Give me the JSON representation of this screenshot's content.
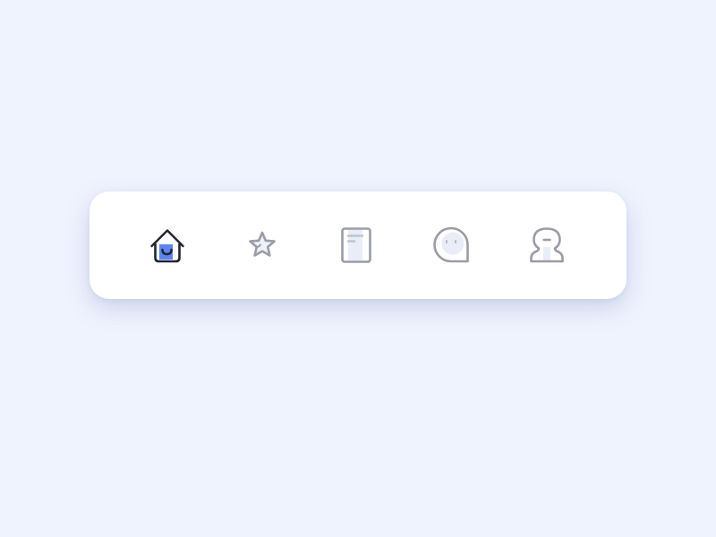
{
  "tabbar": {
    "active_index": 0,
    "colors": {
      "active_stroke": "#23232d",
      "active_fill": "#5b85f5",
      "inactive_stroke": "#9b9ca6",
      "inactive_fill": "#e9edf8",
      "card_background": "#ffffff",
      "page_background": "#eff3fe"
    },
    "tabs": [
      {
        "icon": "home-icon",
        "label": ""
      },
      {
        "icon": "star-icon",
        "label": ""
      },
      {
        "icon": "document-icon",
        "label": ""
      },
      {
        "icon": "chat-bubble-icon",
        "label": ""
      },
      {
        "icon": "profile-icon",
        "label": ""
      }
    ]
  }
}
